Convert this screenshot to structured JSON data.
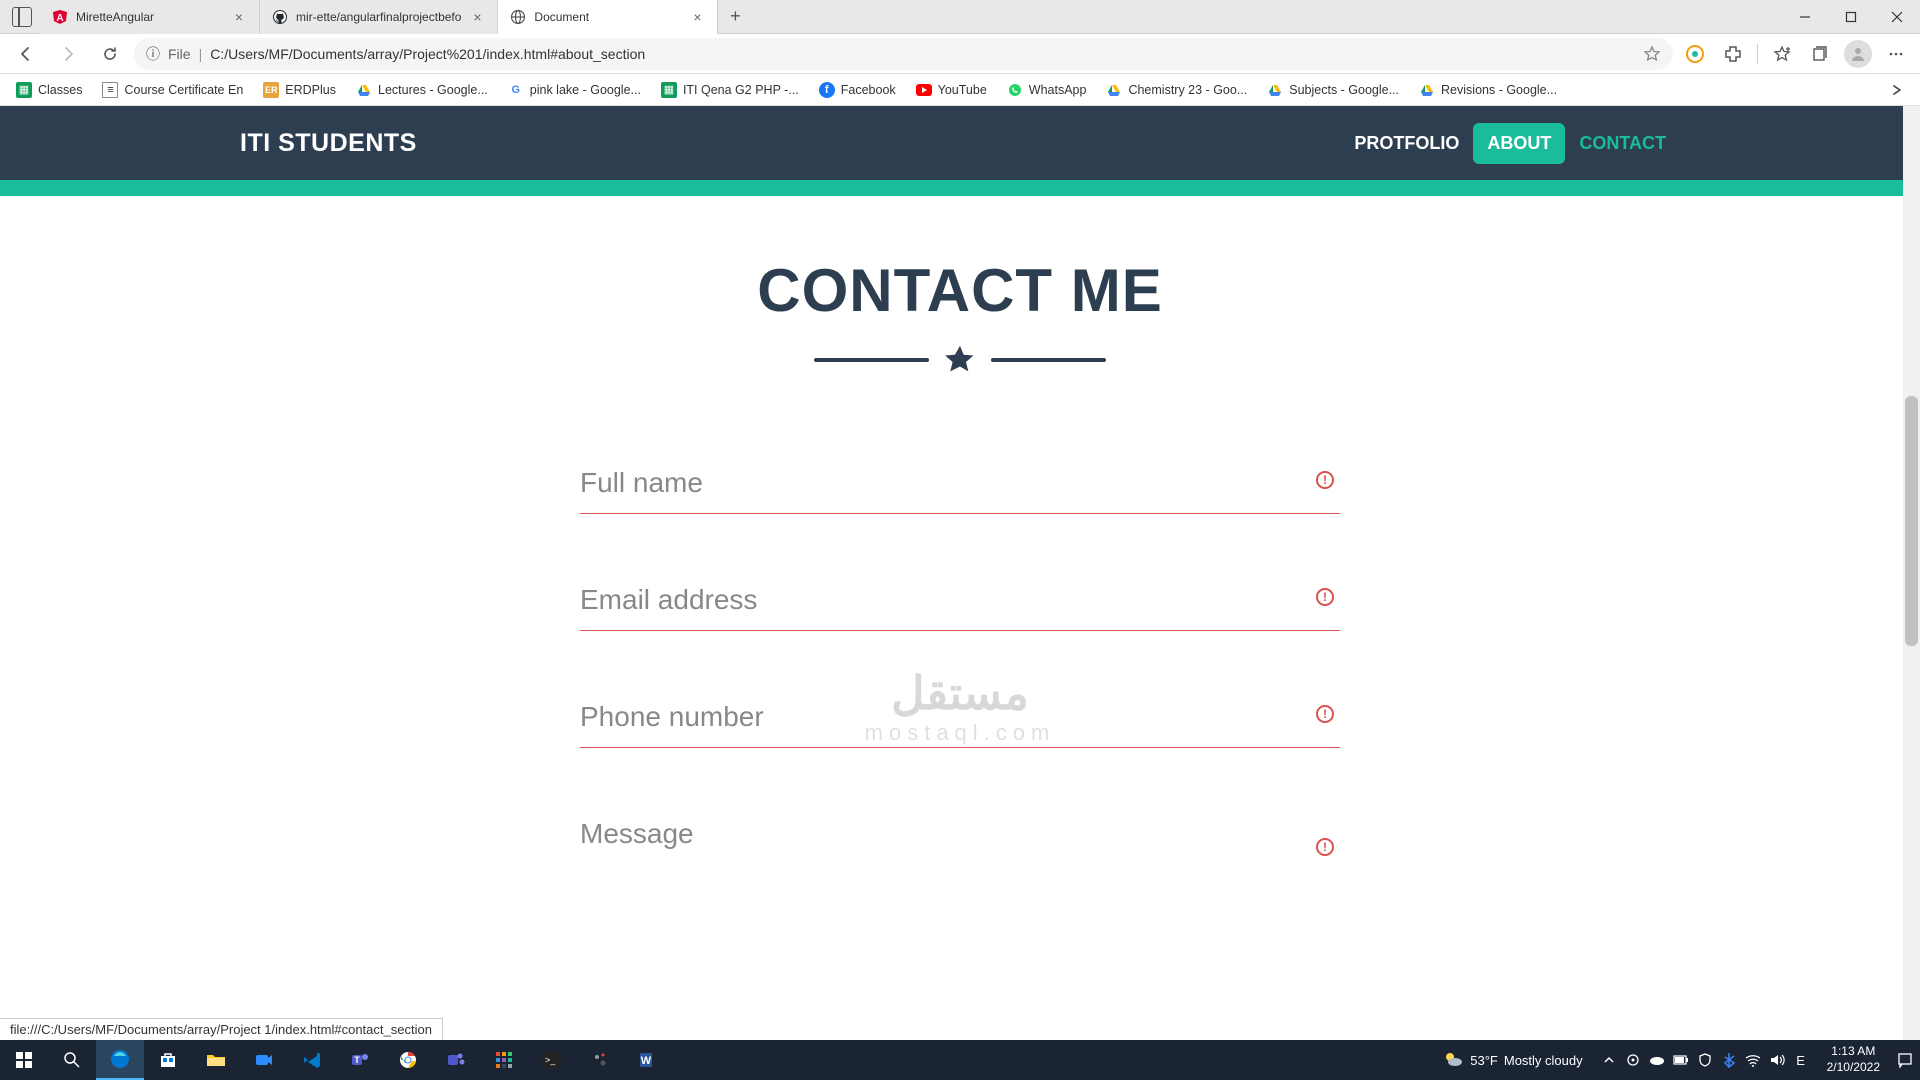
{
  "tabs": [
    {
      "title": "MiretteAngular",
      "icon": "angular"
    },
    {
      "title": "mir-ette/angularfinalprojectbefo",
      "icon": "github"
    },
    {
      "title": "Document",
      "icon": "globe",
      "active": true
    }
  ],
  "url": {
    "prefix": "File",
    "text": "C:/Users/MF/Documents/array/Project%201/index.html#about_section",
    "info_label": "ⓘ"
  },
  "bookmarks": [
    {
      "label": "Classes",
      "icon": "classes",
      "color": "#0f9d58"
    },
    {
      "label": "Course Certificate En",
      "icon": "doc",
      "color": "#555"
    },
    {
      "label": "ERDPlus",
      "icon": "erd",
      "color": "#e8a33d"
    },
    {
      "label": "Lectures - Google...",
      "icon": "drive",
      "color": "#0f9d58"
    },
    {
      "label": "pink lake - Google...",
      "icon": "google",
      "color": "#4285f4"
    },
    {
      "label": "ITI Qena G2 PHP -...",
      "icon": "sheets",
      "color": "#0f9d58"
    },
    {
      "label": "Facebook",
      "icon": "fb",
      "color": "#1877f2"
    },
    {
      "label": "YouTube",
      "icon": "yt",
      "color": "#ff0000"
    },
    {
      "label": "WhatsApp",
      "icon": "wa",
      "color": "#25d366"
    },
    {
      "label": "Chemistry 23 - Goo...",
      "icon": "drive",
      "color": "#0f9d58"
    },
    {
      "label": "Subjects - Google...",
      "icon": "drive",
      "color": "#0f9d58"
    },
    {
      "label": "Revisions - Google...",
      "icon": "drive",
      "color": "#0f9d58"
    }
  ],
  "nav": {
    "brand": "ITI STUDENTS",
    "links": [
      {
        "label": "PROTFOLIO",
        "kind": "normal"
      },
      {
        "label": "ABOUT",
        "kind": "active"
      },
      {
        "label": "CONTACT",
        "kind": "alt"
      }
    ]
  },
  "page": {
    "heading": "CONTACT ME",
    "fields": [
      {
        "label": "Full name"
      },
      {
        "label": "Email address"
      },
      {
        "label": "Phone number"
      },
      {
        "label": "Message"
      }
    ],
    "link_preview": "file:///C:/Users/MF/Documents/array/Project 1/index.html#contact_section"
  },
  "watermark": {
    "main": "مستقل",
    "sub": "mostaql.com"
  },
  "taskbar": {
    "weather": {
      "temp": "53°F",
      "desc": "Mostly cloudy"
    },
    "time": "1:13 AM",
    "date": "2/10/2022",
    "lang": "E"
  }
}
